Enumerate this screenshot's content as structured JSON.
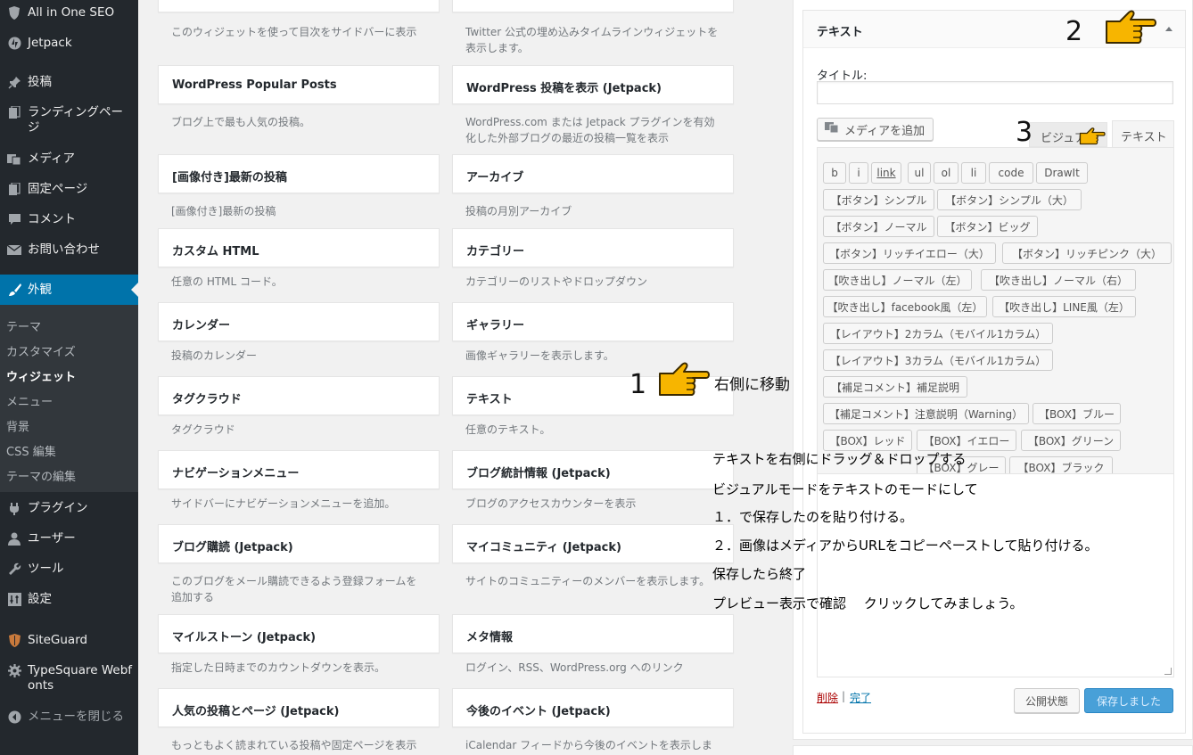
{
  "sidebar": {
    "items": [
      {
        "label": "All in One SEO",
        "icon": "shield-icon"
      },
      {
        "label": "Jetpack",
        "icon": "jetpack-icon"
      },
      {
        "label": "投稿",
        "icon": "pin-icon"
      },
      {
        "label": "ランディングページ",
        "icon": "page-stack-icon"
      },
      {
        "label": "メディア",
        "icon": "media-icon"
      },
      {
        "label": "固定ページ",
        "icon": "page-icon"
      },
      {
        "label": "コメント",
        "icon": "comment-icon"
      },
      {
        "label": "お問い合わせ",
        "icon": "mail-icon"
      },
      {
        "label": "外観",
        "icon": "brush-icon"
      },
      {
        "label": "プラグイン",
        "icon": "plugin-icon"
      },
      {
        "label": "ユーザー",
        "icon": "user-icon"
      },
      {
        "label": "ツール",
        "icon": "wrench-icon"
      },
      {
        "label": "設定",
        "icon": "settings-icon"
      },
      {
        "label": "SiteGuard",
        "icon": "siteguard-shield-icon"
      },
      {
        "label": "TypeSquare Webfonts",
        "icon": "gear-icon"
      },
      {
        "label": "メニューを閉じる",
        "icon": "collapse-icon"
      }
    ],
    "submenu": [
      "テーマ",
      "カスタマイズ",
      "ウィジェット",
      "メニュー",
      "背景",
      "CSS 編集",
      "テーマの編集"
    ],
    "submenu_current": "ウィジェット"
  },
  "widgets": {
    "top_desc_left": "このウィジェットを使って目次をサイドバーに表示",
    "top_desc_right": "Twitter 公式の埋め込みタイムラインウィジェットを表示します。",
    "items": [
      {
        "title": "WordPress Popular Posts",
        "desc": "ブログ上で最も人気の投稿。"
      },
      {
        "title": "WordPress 投稿を表示 (Jetpack)",
        "desc": "WordPress.com または Jetpack プラグインを有効化した外部ブログの最近の投稿一覧を表示"
      },
      {
        "title": "[画像付き]最新の投稿",
        "desc": "[画像付き]最新の投稿"
      },
      {
        "title": "アーカイブ",
        "desc": "投稿の月別アーカイブ"
      },
      {
        "title": "カスタム HTML",
        "desc": "任意の HTML コード。"
      },
      {
        "title": "カテゴリー",
        "desc": "カテゴリーのリストやドロップダウン"
      },
      {
        "title": "カレンダー",
        "desc": "投稿のカレンダー"
      },
      {
        "title": "ギャラリー",
        "desc": "画像ギャラリーを表示します。"
      },
      {
        "title": "タグクラウド",
        "desc": "タグクラウド"
      },
      {
        "title": "テキスト",
        "desc": "任意のテキスト。"
      },
      {
        "title": "ナビゲーションメニュー",
        "desc": "サイドバーにナビゲーションメニューを追加。"
      },
      {
        "title": "ブログ統計情報 (Jetpack)",
        "desc": "ブログのアクセスカウンターを表示"
      },
      {
        "title": "ブログ購読 (Jetpack)",
        "desc": "このブログをメール購読できるよう登録フォームを追加する"
      },
      {
        "title": "マイコミュニティ (Jetpack)",
        "desc": "サイトのコミュニティーのメンバーを表示します。"
      },
      {
        "title": "マイルストーン (Jetpack)",
        "desc": "指定した日時までのカウントダウンを表示。"
      },
      {
        "title": "メタ情報",
        "desc": "ログイン、RSS、WordPress.org へのリンク"
      },
      {
        "title": "人気の投稿とページ (Jetpack)",
        "desc": "もっともよく読まれている投稿や固定ページを表示"
      },
      {
        "title": "今後のイベント (Jetpack)",
        "desc": "iCalendar フィードから今後のイベントを表示しま"
      }
    ]
  },
  "text_widget": {
    "header": "テキスト",
    "title_label": "タイトル:",
    "title_value": "",
    "media_button": "メディアを追加",
    "tab_visual": "ビジュアル",
    "tab_text": "テキスト",
    "quicktags": [
      "b",
      "i",
      "link",
      "ul",
      "ol",
      "li",
      "code",
      "DrawIt",
      "【ボタン】シンプル",
      "【ボタン】シンプル（大）",
      "【ボタン】ノーマル",
      "【ボタン】ビッグ",
      "【ボタン】リッチイエロー（大）",
      "【ボタン】リッチピンク（大）",
      "【吹き出し】ノーマル（左）",
      "【吹き出し】ノーマル（右）",
      "【吹き出し】facebook風（左）",
      "【吹き出し】LINE風（左）",
      "【レイアウト】2カラム（モバイル1カラム）",
      "【レイアウト】3カラム（モバイル1カラム）",
      "【補足コメント】補足説明",
      "【補足コメント】注意説明（Warning）",
      "【BOX】ブルー",
      "【BOX】レッド",
      "【BOX】イエロー",
      "【BOX】グリーン",
      "【BOX】グレー",
      "【BOX】ブラック"
    ],
    "delete_link": "削除",
    "separator": "|",
    "done_link": "完了",
    "publish_button": "公開状態",
    "save_button": "保存しました"
  },
  "annotations": {
    "step1": "1",
    "step1_label": "右側に移動",
    "step2": "2",
    "step3": "3",
    "notes": [
      "テキストを右側にドラッグ＆ドロップする",
      "ビジュアルモードをテキストのモードにして",
      "１．で保存したのを貼り付ける。",
      "２．画像はメディアからURLをコピーペーストして貼り付ける。",
      "保存したら終了",
      "プレビュー表示で確認　 クリックしてみましょう。"
    ]
  },
  "colors": {
    "sidebar_bg": "#23282d",
    "active_menu": "#0073aa",
    "save_button": "#48a0d8",
    "hand": "#f7b500"
  }
}
